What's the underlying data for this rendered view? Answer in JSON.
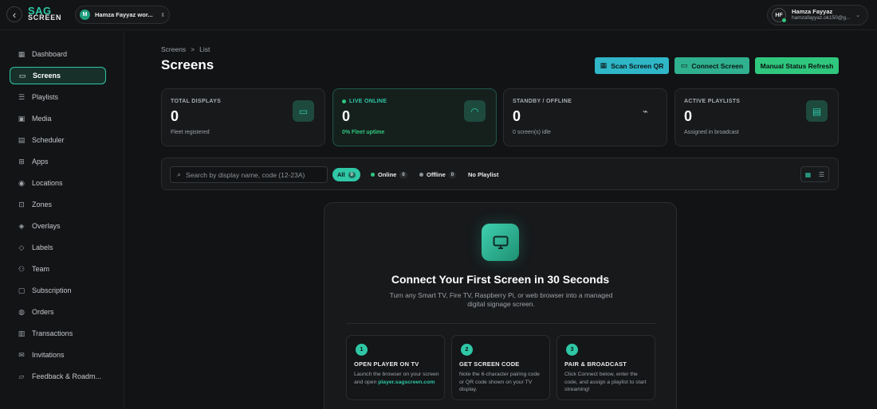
{
  "topbar": {
    "logo_line1": "SAG",
    "logo_line2": "SCREEN",
    "workspace_initial": "M",
    "workspace_name": "Hamza Fayyaz wor...",
    "user_initials": "HF",
    "user_name": "Hamza Fayyaz",
    "user_email": "hamzafayyaz.ok150@g..."
  },
  "sidebar": {
    "items": [
      {
        "label": "Dashboard",
        "icon": "grid-icon"
      },
      {
        "label": "Screens",
        "icon": "monitor-icon"
      },
      {
        "label": "Playlists",
        "icon": "list-icon"
      },
      {
        "label": "Media",
        "icon": "image-icon"
      },
      {
        "label": "Scheduler",
        "icon": "calendar-icon"
      },
      {
        "label": "Apps",
        "icon": "apps-icon"
      },
      {
        "label": "Locations",
        "icon": "pin-icon"
      },
      {
        "label": "Zones",
        "icon": "zones-icon"
      },
      {
        "label": "Overlays",
        "icon": "layers-icon"
      },
      {
        "label": "Labels",
        "icon": "tag-icon"
      },
      {
        "label": "Team",
        "icon": "team-icon"
      },
      {
        "label": "Subscription",
        "icon": "card-icon"
      },
      {
        "label": "Orders",
        "icon": "cart-icon"
      },
      {
        "label": "Transactions",
        "icon": "receipt-icon"
      },
      {
        "label": "Invitations",
        "icon": "mail-icon"
      },
      {
        "label": "Feedback & Roadm...",
        "icon": "chat-icon"
      }
    ]
  },
  "header": {
    "breadcrumb_root": "Screens",
    "breadcrumb_sep": ">",
    "breadcrumb_current": "List",
    "title": "Screens",
    "btn_scan": "Scan Screen QR",
    "btn_connect": "Connect Screen",
    "btn_refresh": "Manual Status Refresh"
  },
  "stats": [
    {
      "label": "TOTAL DISPLAYS",
      "value": "0",
      "sub": "Fleet registered"
    },
    {
      "label": "LIVE ONLINE",
      "value": "0",
      "sub": "0% Fleet uptime"
    },
    {
      "label": "STANDBY / OFFLINE",
      "value": "0",
      "sub": "0 screen(s) idle"
    },
    {
      "label": "ACTIVE PLAYLISTS",
      "value": "0",
      "sub": "Assigned in broadcast"
    }
  ],
  "filters": {
    "search_placeholder": "Search by display name, code (12-23A)",
    "chips": [
      {
        "label": "All",
        "count": "0"
      },
      {
        "label": "Online",
        "count": "0"
      },
      {
        "label": "Offline",
        "count": "0"
      },
      {
        "label": "No Playlist"
      }
    ]
  },
  "empty_state": {
    "title": "Connect Your First Screen in 30 Seconds",
    "description": "Turn any Smart TV, Fire TV, Raspberry Pi, or web browser into a managed digital signage screen.",
    "steps": [
      {
        "num": "1",
        "title": "OPEN PLAYER ON TV",
        "desc": "Launch the browser on your screen and open",
        "link": "player.sagscreen.com"
      },
      {
        "num": "2",
        "title": "GET SCREEN CODE",
        "desc": "Note the 6-character pairing code or QR code shown on your TV display."
      },
      {
        "num": "3",
        "title": "PAIR & BROADCAST",
        "desc": "Click Connect below, enter the code, and assign a playlist to start streaming!"
      }
    ]
  },
  "colors": {
    "accent": "#2fc7a6",
    "online": "#2fc77d",
    "qr_button": "#2fb6c7",
    "background": "#111315"
  }
}
